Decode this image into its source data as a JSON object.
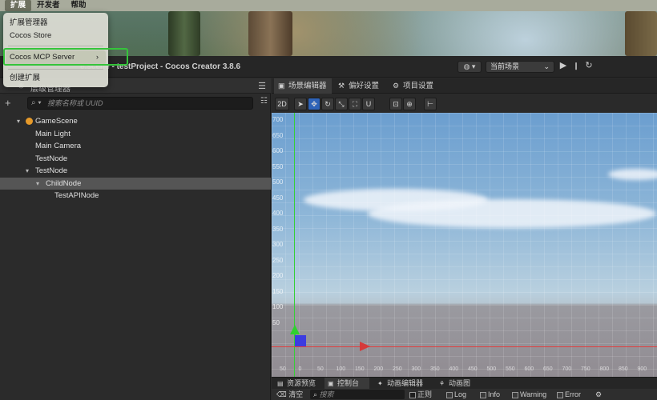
{
  "menubar": {
    "items": [
      "扩展",
      "开发者",
      "帮助"
    ]
  },
  "dropdown": {
    "items": [
      "扩展管理器",
      "Cocos Store",
      "Cocos MCP Server",
      "创建扩展"
    ],
    "submenu_arrow": "›"
  },
  "window": {
    "title": "e.scene - testProject - Cocos Creator 3.8.6",
    "scene_select": "当前场景"
  },
  "hierarchy": {
    "title": "层级管理器",
    "search_placeholder": "搜索名称或 UUID",
    "nodes": [
      "GameScene",
      "Main Light",
      "Main Camera",
      "TestNode",
      "TestNode",
      "ChildNode",
      "TestAPINode"
    ]
  },
  "scene_tabs": [
    "场景编辑器",
    "偏好设置",
    "项目设置"
  ],
  "scene_toolbar": {
    "mode": "2D"
  },
  "viewport": {
    "y_labels": [
      "700",
      "650",
      "600",
      "550",
      "500",
      "450",
      "400",
      "350",
      "300",
      "250",
      "200",
      "150",
      "100",
      "50"
    ],
    "x_labels": [
      "50",
      "0",
      "50",
      "100",
      "150",
      "200",
      "250",
      "300",
      "350",
      "400",
      "450",
      "500",
      "550",
      "600",
      "650",
      "700",
      "750",
      "800",
      "850",
      "900"
    ]
  },
  "bottom_tabs": [
    "资源预览",
    "控制台",
    "动画编辑器",
    "动画图"
  ],
  "console": {
    "clear": "清空",
    "search_placeholder": "搜索",
    "regex": "正则",
    "log": "Log",
    "info": "Info",
    "warning": "Warning",
    "error": "Error"
  },
  "colors": {
    "selection": "#555555",
    "highlight": "#35c43b",
    "axis_y": "#34d034",
    "axis_x": "#e04040"
  }
}
